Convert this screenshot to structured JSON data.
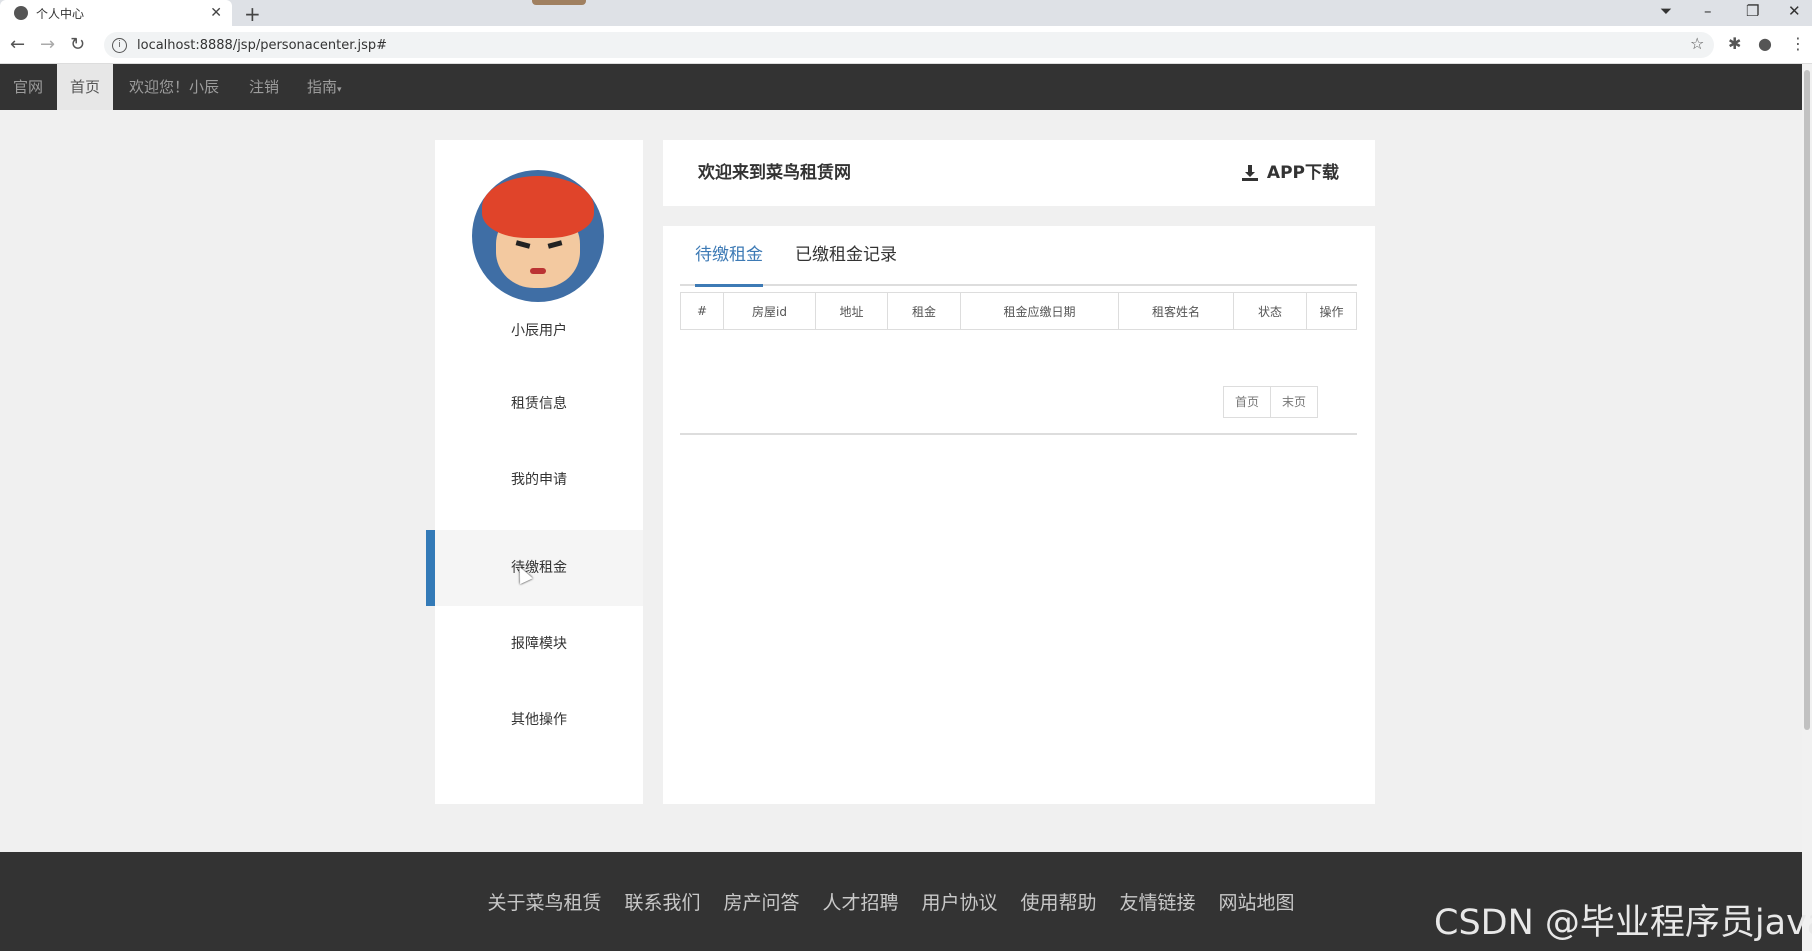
{
  "browser": {
    "tab_title": "个人中心",
    "url": "localhost:8888/jsp/personacenter.jsp#"
  },
  "navbar": {
    "items": [
      "官网",
      "首页",
      "欢迎您！小辰",
      "注销",
      "指南"
    ]
  },
  "sidebar": {
    "username": "小辰用户",
    "menu": [
      "租赁信息",
      "我的申请",
      "待缴租金",
      "报障模块",
      "其他操作"
    ],
    "active_index": 2
  },
  "header": {
    "welcome": "欢迎来到菜鸟租赁网",
    "app_download": "APP下载"
  },
  "tabs": [
    "待缴租金",
    "已缴租金记录"
  ],
  "table": {
    "headers": [
      "#",
      "房屋id",
      "地址",
      "租金",
      "租金应缴日期",
      "租客姓名",
      "状态",
      "操作"
    ]
  },
  "pager": [
    "首页",
    "末页"
  ],
  "footer": {
    "links": [
      "关于菜鸟租赁",
      "联系我们",
      "房产问答",
      "人才招聘",
      "用户协议",
      "使用帮助",
      "友情链接",
      "网站地图"
    ]
  },
  "watermark": "CSDN @毕业程序员java",
  "colors": {
    "navbar_bg": "#333333",
    "accent": "#3d7ab5",
    "active_bar": "#337ab7",
    "page_bg": "#f0f0f0"
  }
}
